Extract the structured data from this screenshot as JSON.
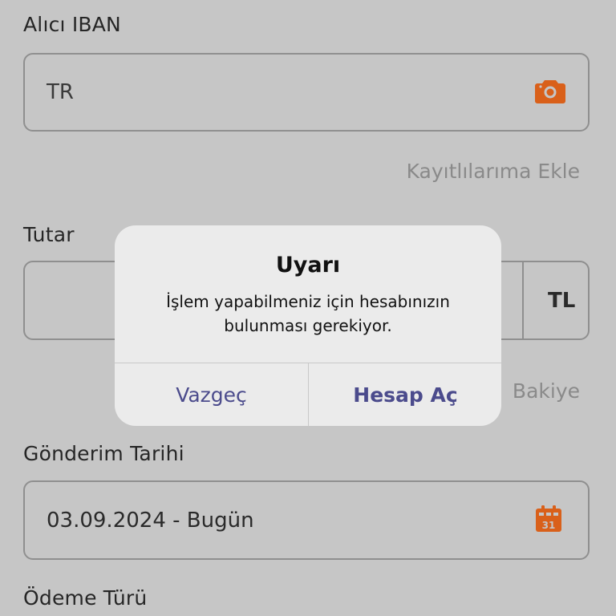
{
  "iban": {
    "label": "Alıcı IBAN",
    "value": "TR",
    "camera_icon": "camera-icon",
    "save_link": "Kayıtlılarıma Ekle"
  },
  "amount": {
    "label": "Tutar",
    "currency": "TL",
    "balance_link_partial": "Bakiye"
  },
  "date": {
    "label": "Gönderim Tarihi",
    "value": "03.09.2024 - Bugün",
    "calendar_icon": "calendar-icon",
    "calendar_day": "31"
  },
  "payment_type": {
    "label": "Ödeme Türü"
  },
  "dialog": {
    "title": "Uyarı",
    "message": "İşlem yapabilmeniz için hesabınızın bulunması gerekiyor.",
    "cancel_label": "Vazgeç",
    "confirm_label": "Hesap Aç"
  },
  "colors": {
    "overlay_bg": "#c6c6c6",
    "accent_orange": "#d9601a",
    "dialog_button": "#4b4b8c"
  }
}
